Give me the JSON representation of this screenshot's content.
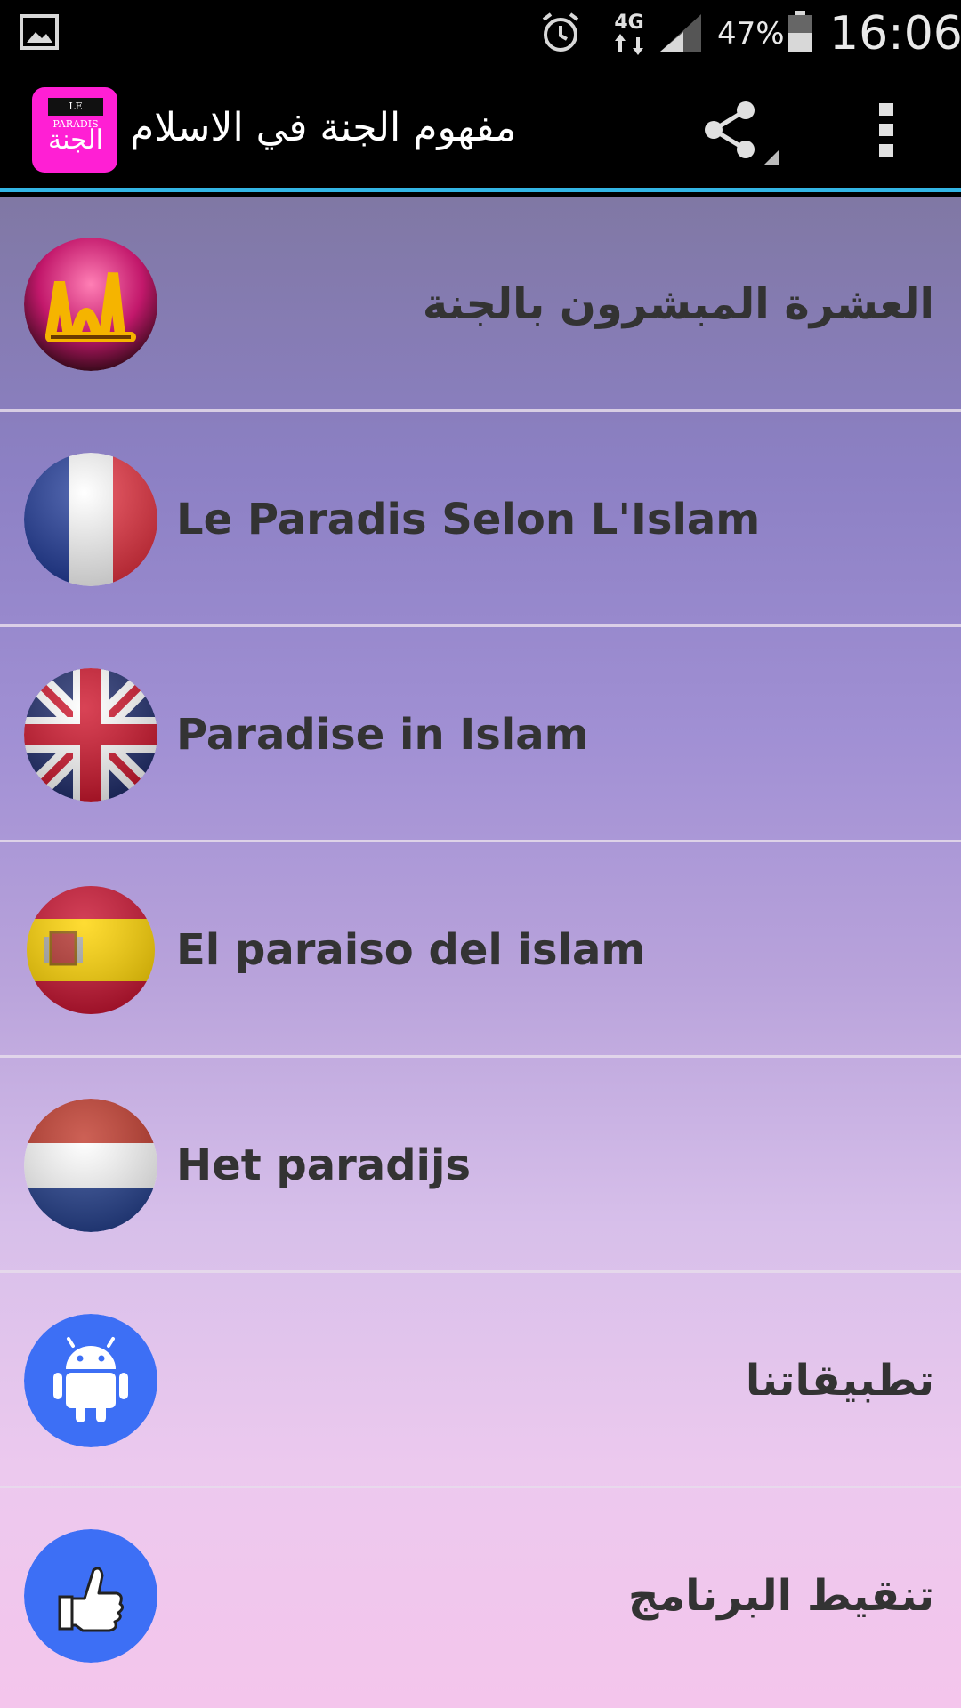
{
  "status_bar": {
    "network": "4G",
    "battery": "47%",
    "time": "16:06",
    "icons": [
      "gallery-icon",
      "alarm-icon",
      "signal-icon",
      "battery-icon"
    ]
  },
  "action_bar": {
    "logo_text_top": "LE PARADIS",
    "logo_text_script": "الجنة",
    "title": "مفهوم الجنة في الاسلام",
    "share_icon": "share-icon",
    "overflow_icon": "overflow-menu-icon"
  },
  "list": {
    "items": [
      {
        "label": "العشرة المبشرون بالجنة",
        "icon": "paradise-calligraphy-icon",
        "dir": "rtl"
      },
      {
        "label": "Le Paradis Selon L'Islam",
        "icon": "france-flag-icon",
        "dir": "ltr"
      },
      {
        "label": "Paradise in Islam",
        "icon": "uk-flag-icon",
        "dir": "ltr"
      },
      {
        "label": "El paraiso del islam",
        "icon": "spain-flag-icon",
        "dir": "ltr"
      },
      {
        "label": "Het paradijs",
        "icon": "netherlands-flag-icon",
        "dir": "ltr"
      },
      {
        "label": "تطبيقاتنا",
        "icon": "android-icon",
        "dir": "rtl"
      },
      {
        "label": "تنقيط البرنامج",
        "icon": "thumbs-up-icon",
        "dir": "rtl"
      }
    ]
  },
  "colors": {
    "action_bar_accent": "#33b5e5",
    "logo_bg": "#ff1fd4",
    "blue_icon_bg": "#3d6ff5"
  }
}
